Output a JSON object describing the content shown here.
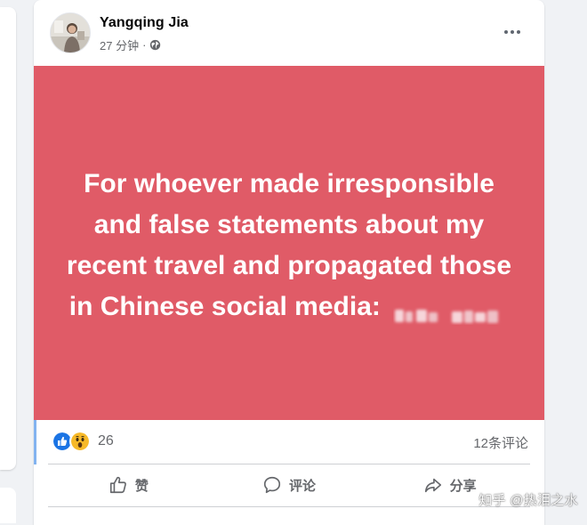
{
  "post": {
    "author": "Yangqing Jia",
    "timestamp": "27 分钟",
    "separator": "·",
    "audience_icon": "globe-icon",
    "more_icon": "more-horizontal-icon",
    "media": {
      "background_color": "#e05b67",
      "text_color": "#ffffff",
      "text_main": "For whoever made irresponsible and false statements about my recent travel and propagated those in Chinese social media:",
      "blurred_name_note": "blurred-name"
    },
    "reactions": {
      "icons": [
        "like-reaction-icon",
        "wow-reaction-icon"
      ],
      "count": "26"
    },
    "comments_count_label": "12条评论",
    "actions": {
      "like_label": "赞",
      "comment_label": "评论",
      "share_label": "分享"
    }
  },
  "watermark": "知乎 @热泪之水",
  "colors": {
    "page_bg": "#f0f2f5",
    "card_bg": "#ffffff",
    "secondary_text": "#65676b",
    "like_blue": "#1b74e4",
    "wow_yellow": "#f7b928"
  }
}
